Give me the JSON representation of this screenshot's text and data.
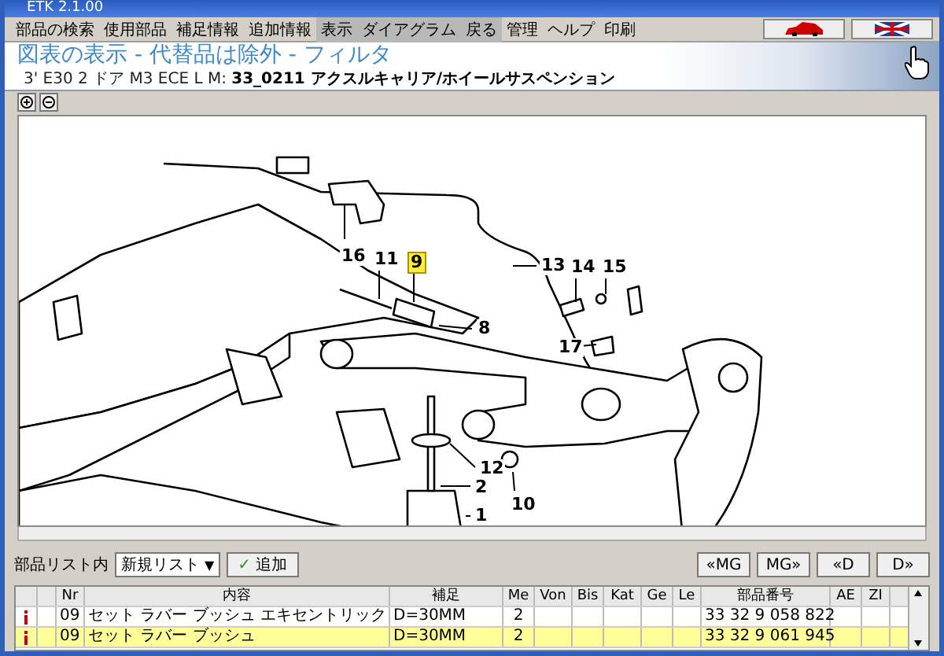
{
  "window": {
    "title": "ETK 2.1.00"
  },
  "menu": [
    {
      "label": "部品の検索",
      "active": false
    },
    {
      "label": "使用部品",
      "active": false
    },
    {
      "label": "補足情報",
      "active": false
    },
    {
      "label": "追加情報",
      "active": false
    },
    {
      "label": "表示",
      "active": true
    },
    {
      "label": "ダイアグラム",
      "active": true
    },
    {
      "label": "戻る",
      "active": true
    },
    {
      "label": "管理",
      "active": false
    },
    {
      "label": "ヘルプ",
      "active": false
    },
    {
      "label": "印刷",
      "active": false
    }
  ],
  "header": {
    "title": "図表の表示 - 代替品は除外 - フィルタ",
    "subtitle": "3' E30 2 ドア M3 ECE  L M: **33_0211 アクスルキャリア/ホイールサスペンション**"
  },
  "callouts": [
    {
      "label": "16",
      "selected": false
    },
    {
      "label": "11",
      "selected": false
    },
    {
      "label": "9",
      "selected": true
    },
    {
      "label": "13",
      "selected": false
    },
    {
      "label": "14",
      "selected": false
    },
    {
      "label": "15",
      "selected": false
    },
    {
      "label": "8",
      "selected": false
    },
    {
      "label": "17",
      "selected": false
    },
    {
      "label": "12",
      "selected": false
    },
    {
      "label": "2",
      "selected": false
    },
    {
      "label": "10",
      "selected": false
    },
    {
      "label": "1",
      "selected": false
    }
  ],
  "list_bar": {
    "label": "部品リスト内",
    "dropdown": "新規リスト",
    "dropdown_arrow": "▼",
    "add_icon": "✓",
    "add_button": "追加",
    "nav_buttons": [
      "«MG",
      "MG»",
      "«D",
      "D»"
    ]
  },
  "table": {
    "columns": [
      "",
      "",
      "Nr",
      "内容",
      "補足",
      "Me",
      "Von",
      "Bis",
      "Kat",
      "Ge",
      "Le",
      "部品番号",
      "AE",
      "ZI"
    ],
    "rows": [
      {
        "selected": false,
        "cells": [
          "",
          "",
          "09",
          "セット ラバー ブッシュ エキセントリック",
          "D=30MM",
          "2",
          "",
          "",
          "",
          "",
          "",
          "33 32 9 058 822",
          "",
          ""
        ]
      },
      {
        "selected": true,
        "cells": [
          "",
          "",
          "09",
          "セット ラバー ブッシュ",
          "D=30MM",
          "2",
          "",
          "",
          "",
          "",
          "",
          "33 32 9 061 945",
          "",
          ""
        ]
      }
    ]
  }
}
